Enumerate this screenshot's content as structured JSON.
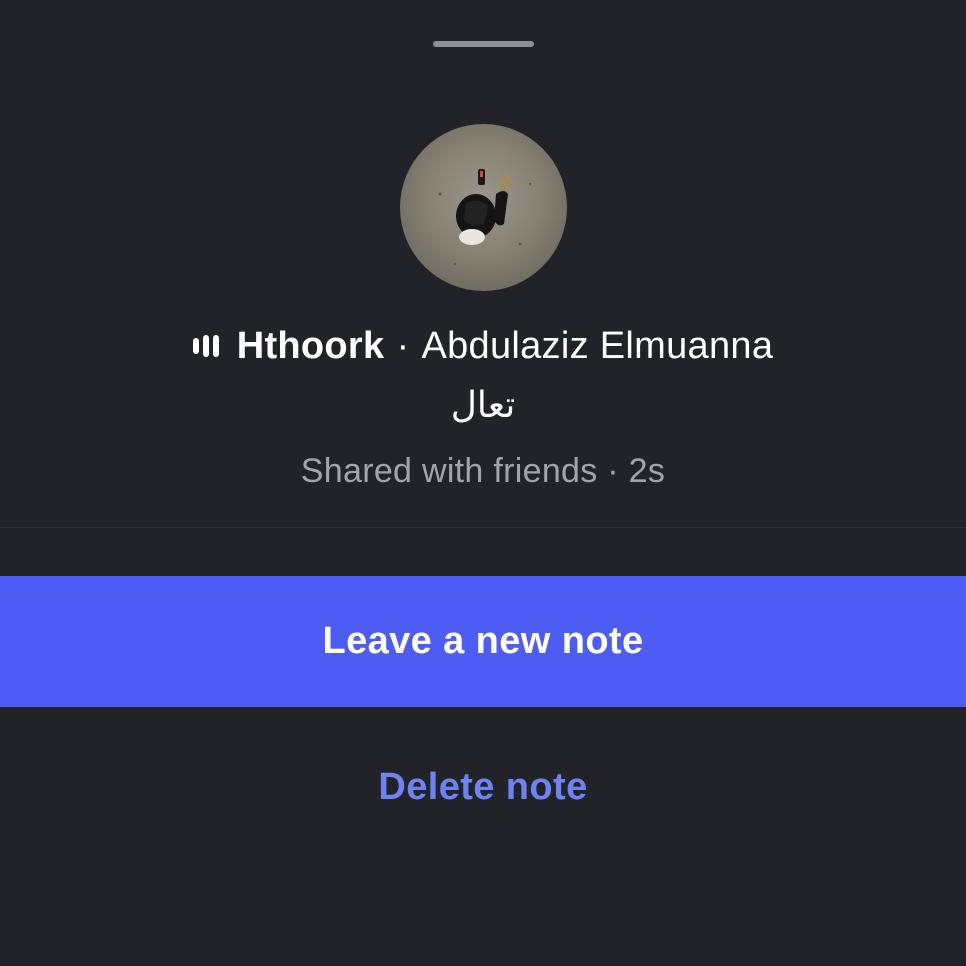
{
  "sheet": {
    "handle_icon": "drag-handle"
  },
  "note": {
    "avatar_icon": "profile-photo",
    "music_icon": "music-bars-icon",
    "song_title": "Hthoork",
    "separator": "·",
    "artist": "Abdulaziz Elmuanna",
    "text": "تعال",
    "audience": "Shared with friends",
    "time_separator": "·",
    "age": "2s"
  },
  "actions": {
    "primary_label": "Leave a new note",
    "secondary_label": "Delete note"
  },
  "colors": {
    "background": "#222328",
    "primary": "#4c5cf5",
    "link": "#6d82f3",
    "muted_text": "#a3a4aa"
  }
}
